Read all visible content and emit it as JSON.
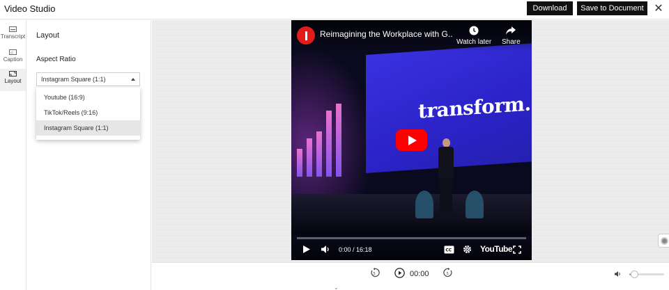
{
  "header": {
    "app_title": "Video Studio",
    "download_label": "Download",
    "save_label": "Save to Document",
    "close_glyph": "✕"
  },
  "rail": {
    "items": [
      {
        "label": "Transcript",
        "icon": "transcript-icon"
      },
      {
        "label": "Caption",
        "icon": "caption-icon"
      },
      {
        "label": "Layout",
        "icon": "layout-icon",
        "active": true
      }
    ]
  },
  "panel": {
    "title": "Layout",
    "aspect_ratio_label": "Aspect Ratio",
    "selected_value": "Instagram Square (1:1)",
    "options": [
      "Youtube (16:9)",
      "TikTok/Reels (9:16)",
      "Instagram Square (1:1)"
    ]
  },
  "video": {
    "title": "Reimagining the Workplace with G...",
    "watch_later_label": "Watch later",
    "share_label": "Share",
    "screen_text": "transform.",
    "time_display": "0:00 / 16:18",
    "logo_text": "YouTube",
    "progress": 0
  },
  "bottom_bar": {
    "time": "00:00",
    "volume": 0.14
  },
  "colors": {
    "accent_dark": "#111111",
    "youtube_red": "#ff0000",
    "stage_blue": "#2b23c8"
  }
}
